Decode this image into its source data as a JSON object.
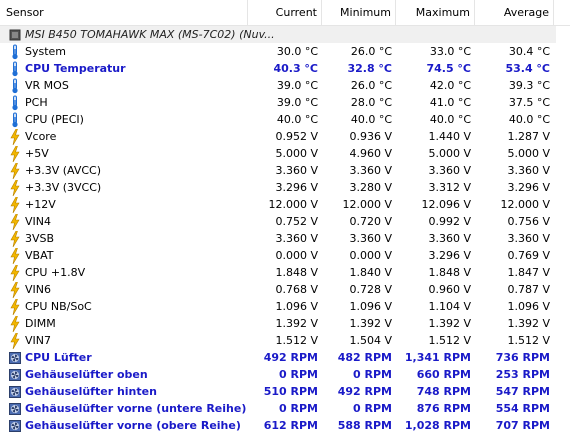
{
  "header": {
    "sensor": "Sensor",
    "current": "Current",
    "minimum": "Minimum",
    "maximum": "Maximum",
    "average": "Average"
  },
  "group_label": "MSI B450 TOMAHAWK MAX (MS-7C02) (Nuv...",
  "rows": [
    {
      "name": "System",
      "icon": "thermometer",
      "cur": "30.0 °C",
      "min": "26.0 °C",
      "max": "33.0 °C",
      "avg": "30.4 °C"
    },
    {
      "name": "CPU Temperatur",
      "icon": "thermometer",
      "cur": "40.3 °C",
      "min": "32.8 °C",
      "max": "74.5 °C",
      "avg": "53.4 °C",
      "bold": true
    },
    {
      "name": "VR MOS",
      "icon": "thermometer",
      "cur": "39.0 °C",
      "min": "26.0 °C",
      "max": "42.0 °C",
      "avg": "39.3 °C"
    },
    {
      "name": "PCH",
      "icon": "thermometer",
      "cur": "39.0 °C",
      "min": "28.0 °C",
      "max": "41.0 °C",
      "avg": "37.5 °C"
    },
    {
      "name": "CPU (PECI)",
      "icon": "thermometer",
      "cur": "40.0 °C",
      "min": "40.0 °C",
      "max": "40.0 °C",
      "avg": "40.0 °C"
    },
    {
      "name": "Vcore",
      "icon": "bolt",
      "cur": "0.952 V",
      "min": "0.936 V",
      "max": "1.440 V",
      "avg": "1.287 V"
    },
    {
      "name": "+5V",
      "icon": "bolt",
      "cur": "5.000 V",
      "min": "4.960 V",
      "max": "5.000 V",
      "avg": "5.000 V"
    },
    {
      "name": "+3.3V (AVCC)",
      "icon": "bolt",
      "cur": "3.360 V",
      "min": "3.360 V",
      "max": "3.360 V",
      "avg": "3.360 V"
    },
    {
      "name": "+3.3V (3VCC)",
      "icon": "bolt",
      "cur": "3.296 V",
      "min": "3.280 V",
      "max": "3.312 V",
      "avg": "3.296 V"
    },
    {
      "name": "+12V",
      "icon": "bolt",
      "cur": "12.000 V",
      "min": "12.000 V",
      "max": "12.096 V",
      "avg": "12.000 V"
    },
    {
      "name": "VIN4",
      "icon": "bolt",
      "cur": "0.752 V",
      "min": "0.720 V",
      "max": "0.992 V",
      "avg": "0.756 V"
    },
    {
      "name": "3VSB",
      "icon": "bolt",
      "cur": "3.360 V",
      "min": "3.360 V",
      "max": "3.360 V",
      "avg": "3.360 V"
    },
    {
      "name": "VBAT",
      "icon": "bolt",
      "cur": "0.000 V",
      "min": "0.000 V",
      "max": "3.296 V",
      "avg": "0.769 V"
    },
    {
      "name": "CPU +1.8V",
      "icon": "bolt",
      "cur": "1.848 V",
      "min": "1.840 V",
      "max": "1.848 V",
      "avg": "1.847 V"
    },
    {
      "name": "VIN6",
      "icon": "bolt",
      "cur": "0.768 V",
      "min": "0.728 V",
      "max": "0.960 V",
      "avg": "0.787 V"
    },
    {
      "name": "CPU NB/SoC",
      "icon": "bolt",
      "cur": "1.096 V",
      "min": "1.096 V",
      "max": "1.104 V",
      "avg": "1.096 V"
    },
    {
      "name": "DIMM",
      "icon": "bolt",
      "cur": "1.392 V",
      "min": "1.392 V",
      "max": "1.392 V",
      "avg": "1.392 V"
    },
    {
      "name": "VIN7",
      "icon": "bolt",
      "cur": "1.512 V",
      "min": "1.504 V",
      "max": "1.512 V",
      "avg": "1.512 V"
    },
    {
      "name": "CPU Lüfter",
      "icon": "fan",
      "cur": "492 RPM",
      "min": "482 RPM",
      "max": "1,341 RPM",
      "avg": "736 RPM",
      "bold": true
    },
    {
      "name": "Gehäuselüfter oben",
      "icon": "fan",
      "cur": "0 RPM",
      "min": "0 RPM",
      "max": "660 RPM",
      "avg": "253 RPM",
      "bold": true
    },
    {
      "name": "Gehäuselüfter hinten",
      "icon": "fan",
      "cur": "510 RPM",
      "min": "492 RPM",
      "max": "748 RPM",
      "avg": "547 RPM",
      "bold": true
    },
    {
      "name": "Gehäuselüfter vorne (untere Reihe)",
      "icon": "fan",
      "cur": "0 RPM",
      "min": "0 RPM",
      "max": "876 RPM",
      "avg": "554 RPM",
      "bold": true
    },
    {
      "name": "Gehäuselüfter vorne (obere Reihe)",
      "icon": "fan",
      "cur": "612 RPM",
      "min": "588 RPM",
      "max": "1,028 RPM",
      "avg": "707 RPM",
      "bold": true
    }
  ],
  "colors": {
    "bold_text": "#1a1ac8",
    "header_border": "#e5e5e5",
    "group_bg": "#f0f0f0",
    "bolt": "#f2b600",
    "thermo": "#1f6fd6",
    "fan": "#3b5fa8"
  }
}
